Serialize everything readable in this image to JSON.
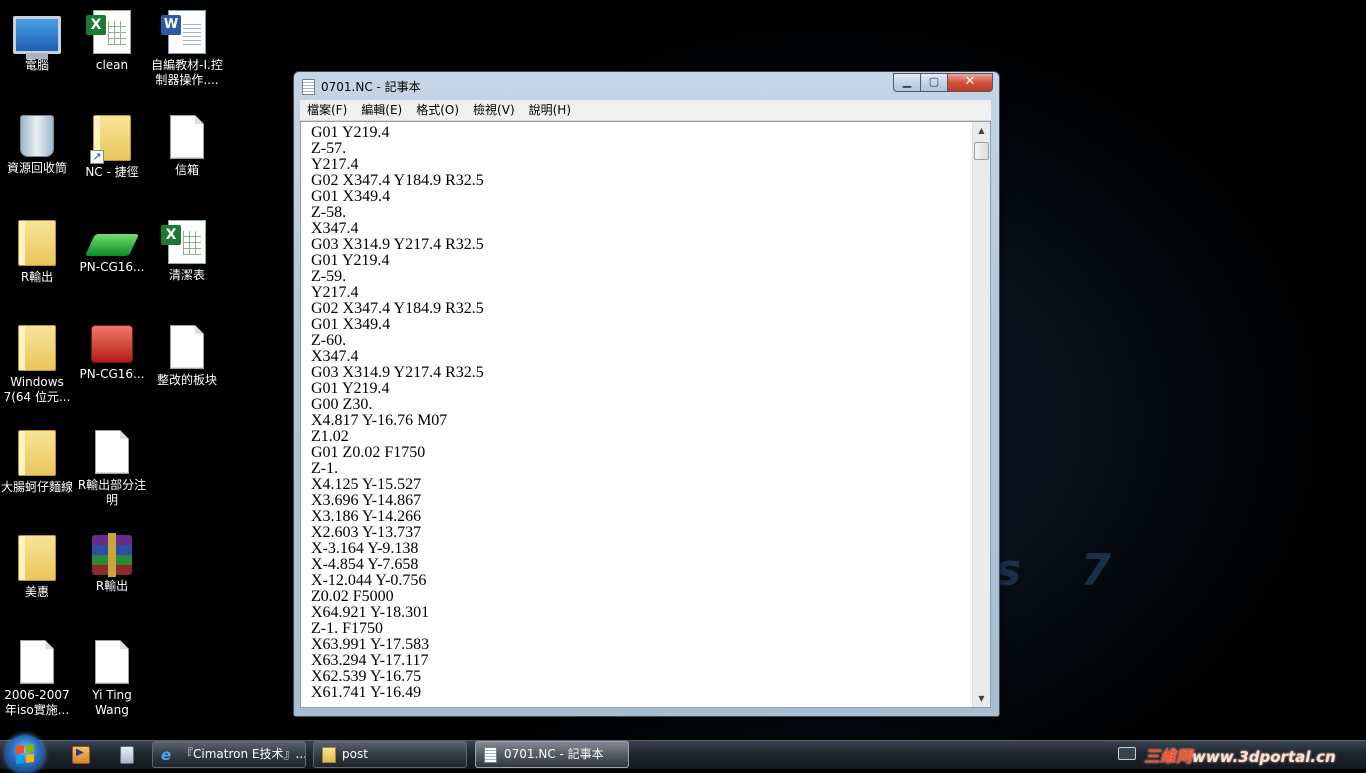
{
  "desktop": {
    "icons": [
      {
        "label": "電腦",
        "icon": "computer-icon"
      },
      {
        "label": "clean",
        "icon": "excel-file-icon"
      },
      {
        "label": "自編教材-I.控制器操作....",
        "icon": "word-file-icon"
      },
      {
        "label": "資源回收筒",
        "icon": "recycle-bin-icon"
      },
      {
        "label": "NC - 捷徑",
        "icon": "folder-shortcut-icon"
      },
      {
        "label": "信箱",
        "icon": "text-file-icon"
      },
      {
        "label": "R輸出",
        "icon": "folder-icon"
      },
      {
        "label": "PN-CG16...",
        "icon": "green-app-icon"
      },
      {
        "label": "清潔表",
        "icon": "excel-file-icon"
      },
      {
        "label": "Windows 7(64 位元...",
        "icon": "folder-icon"
      },
      {
        "label": "PN-CG16...",
        "icon": "red-app-icon"
      },
      {
        "label": "整改的板块",
        "icon": "text-file-icon"
      },
      {
        "label": "大腸蚵仔麵線",
        "icon": "folder-icon"
      },
      {
        "label": "R輸出部分注明",
        "icon": "text-file-icon"
      },
      {
        "label": "美惠",
        "icon": "folder-icon"
      },
      {
        "label": "R輸出",
        "icon": "rar-archive-icon"
      },
      {
        "label": "2006-2007年iso實施...",
        "icon": "text-file-icon"
      },
      {
        "label": "Yi Ting Wang",
        "icon": "text-file-icon"
      }
    ],
    "wallpaper_text": "s 7"
  },
  "notepad": {
    "title": "0701.NC - 記事本",
    "buttons": {
      "minimize": "▁",
      "maximize": "▢",
      "close": "✕"
    },
    "menu": [
      "檔案(F)",
      "編輯(E)",
      "格式(O)",
      "檢視(V)",
      "說明(H)"
    ],
    "lines": [
      "G01 Y219.4",
      "Z-57.",
      "Y217.4",
      "G02 X347.4 Y184.9 R32.5",
      "G01 X349.4",
      "Z-58.",
      "X347.4",
      "G03 X314.9 Y217.4 R32.5",
      "G01 Y219.4",
      "Z-59.",
      "Y217.4",
      "G02 X347.4 Y184.9 R32.5",
      "G01 X349.4",
      "Z-60.",
      "X347.4",
      "G03 X314.9 Y217.4 R32.5",
      "G01 Y219.4",
      "G00 Z30.",
      "X4.817 Y-16.76 M07",
      "Z1.02",
      "G01 Z0.02 F1750",
      "Z-1.",
      "X4.125 Y-15.527",
      "X3.696 Y-14.867",
      "X3.186 Y-14.266",
      "X2.603 Y-13.737",
      "X-3.164 Y-9.138",
      "X-4.854 Y-7.658",
      "X-12.044 Y-0.756",
      "Z0.02 F5000",
      "X64.921 Y-18.301",
      "Z-1. F1750",
      "X63.991 Y-17.583",
      "X63.294 Y-17.117",
      "X62.539 Y-16.75",
      "X61.741 Y-16.49"
    ]
  },
  "taskbar": {
    "tasks": [
      {
        "label": "『Cimatron E技术』...",
        "icon": "internet-explorer-icon",
        "active": false
      },
      {
        "label": "post",
        "icon": "folder-icon",
        "active": false
      },
      {
        "label": "0701.NC - 記事本",
        "icon": "notepad-icon",
        "active": true
      }
    ],
    "watermark": "三维网",
    "watermark_url": "www.3dportal.cn"
  }
}
